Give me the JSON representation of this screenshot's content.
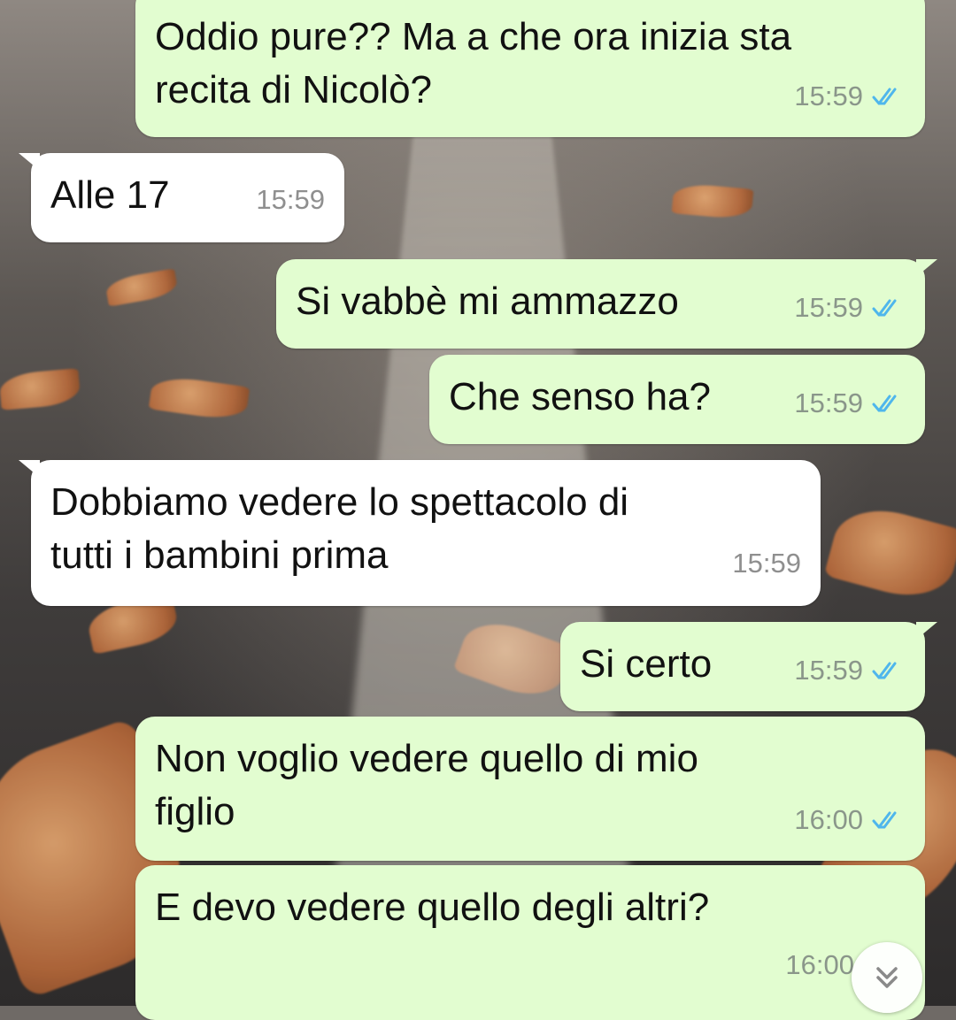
{
  "chat": {
    "messages": [
      {
        "direction": "outgoing",
        "text": "Oddio pure?? Ma a che ora inizia sta\nrecita di Nicolò?",
        "time": "15:59",
        "status": "read"
      },
      {
        "direction": "incoming",
        "text": "Alle 17",
        "time": "15:59"
      },
      {
        "direction": "outgoing",
        "text": "Si vabbè mi ammazzo",
        "time": "15:59",
        "status": "read"
      },
      {
        "direction": "outgoing",
        "text": "Che senso ha?",
        "time": "15:59",
        "status": "read"
      },
      {
        "direction": "incoming",
        "text": "Dobbiamo vedere lo spettacolo di\ntutti i bambini prima",
        "time": "15:59"
      },
      {
        "direction": "outgoing",
        "text": "Si certo",
        "time": "15:59",
        "status": "read"
      },
      {
        "direction": "outgoing",
        "text": "Non voglio vedere quello di mio\nfiglio",
        "time": "16:00",
        "status": "read"
      },
      {
        "direction": "outgoing",
        "text": "E devo vedere quello degli altri?",
        "time": "16:00",
        "status": "read"
      }
    ]
  },
  "icons": {
    "read_receipt": "double-check-icon",
    "scroll_down": "chevron-double-down-icon"
  },
  "colors": {
    "outgoing_bubble": "#e2fdd0",
    "incoming_bubble": "#ffffff",
    "read_ticks": "#4fb6ec",
    "timestamp": "#8a968a"
  }
}
